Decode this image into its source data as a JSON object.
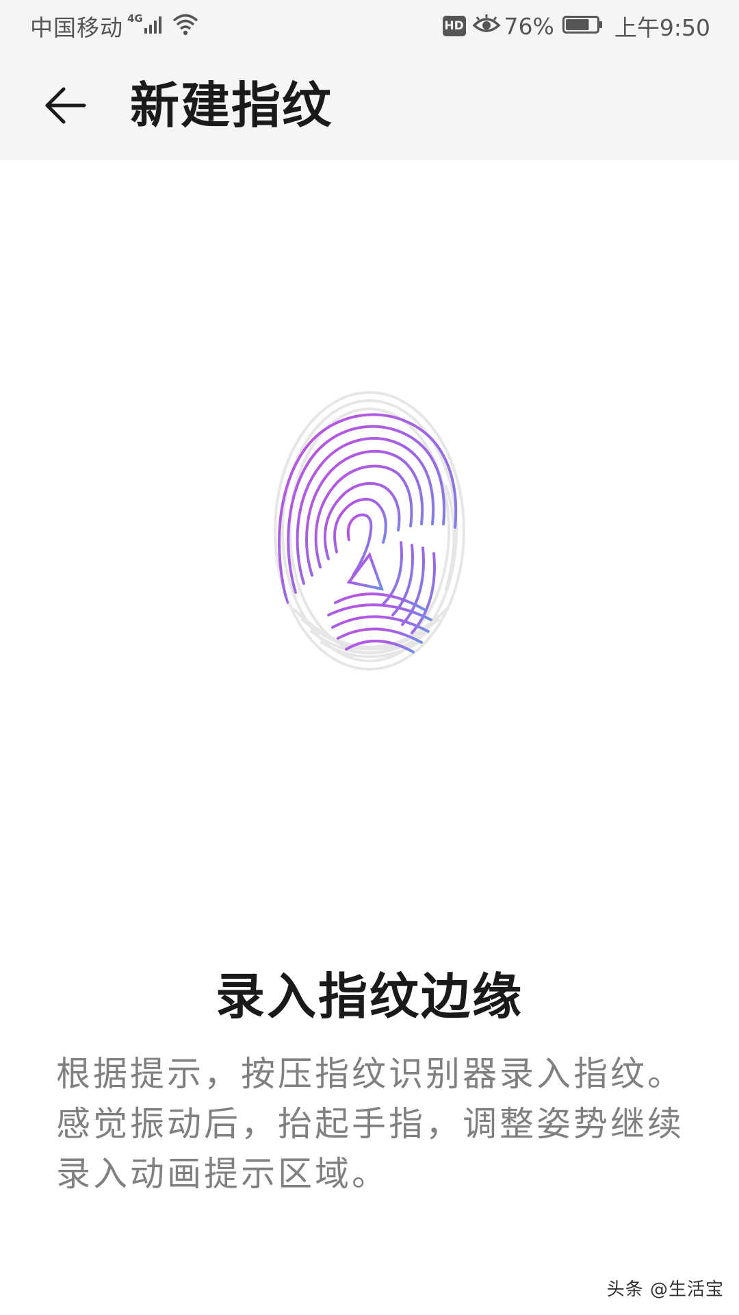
{
  "status_bar": {
    "carrier": "中国移动",
    "network": "4G",
    "hd_badge": "HD",
    "battery_percent": "76%",
    "battery_level": 0.76,
    "time": "上午9:50",
    "icons": [
      "signal-icon",
      "wifi-icon",
      "eye-icon",
      "battery-icon"
    ]
  },
  "app_bar": {
    "back_icon": "arrow-left-icon",
    "title": "新建指纹"
  },
  "main": {
    "illustration": "fingerprint-icon",
    "instruction_title": "录入指纹边缘",
    "instruction_text": "根据提示，按压指纹识别器录入指纹。感觉振动后，抬起手指，调整姿势继续录入动画提示区域。"
  },
  "watermark": "头条 @生活宝",
  "colors": {
    "bar_background": "#f5f5f5",
    "title_text": "#1a1a1a",
    "body_text": "#808080",
    "fingerprint_gradient_top": "#c04fe0",
    "fingerprint_gradient_bottom": "#6f8fe8",
    "fingerprint_unfilled": "#e6e6e6"
  }
}
